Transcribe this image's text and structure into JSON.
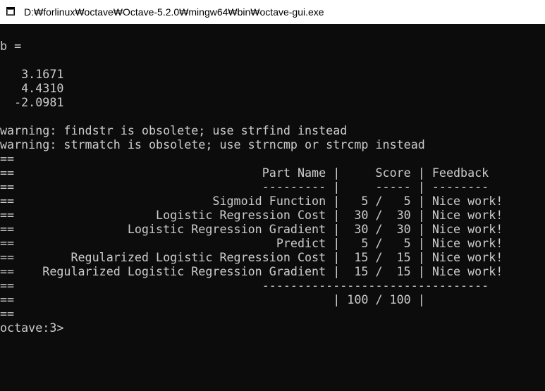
{
  "window": {
    "title": "D:₩forlinux₩octave₩Octave-5.2.0₩mingw64₩bin₩octave-gui.exe",
    "icon": "console-window-icon"
  },
  "console": {
    "lines": [
      "b =",
      "",
      "   3.1671",
      "   4.4310",
      "  -2.0981",
      "",
      "warning: findstr is obsolete; use strfind instead",
      "warning: strmatch is obsolete; use strncmp or strcmp instead",
      "==",
      "==                                   Part Name |     Score | Feedback",
      "==                                   --------- |     ----- | --------",
      "==                            Sigmoid Function |   5 /   5 | Nice work!",
      "==                    Logistic Regression Cost |  30 /  30 | Nice work!",
      "==                Logistic Regression Gradient |  30 /  30 | Nice work!",
      "==                                     Predict |   5 /   5 | Nice work!",
      "==        Regularized Logistic Regression Cost |  15 /  15 | Nice work!",
      "==    Regularized Logistic Regression Gradient |  15 /  15 | Nice work!",
      "==                                   --------------------------------",
      "==                                             | 100 / 100 |",
      "==",
      "octave:3>"
    ]
  }
}
